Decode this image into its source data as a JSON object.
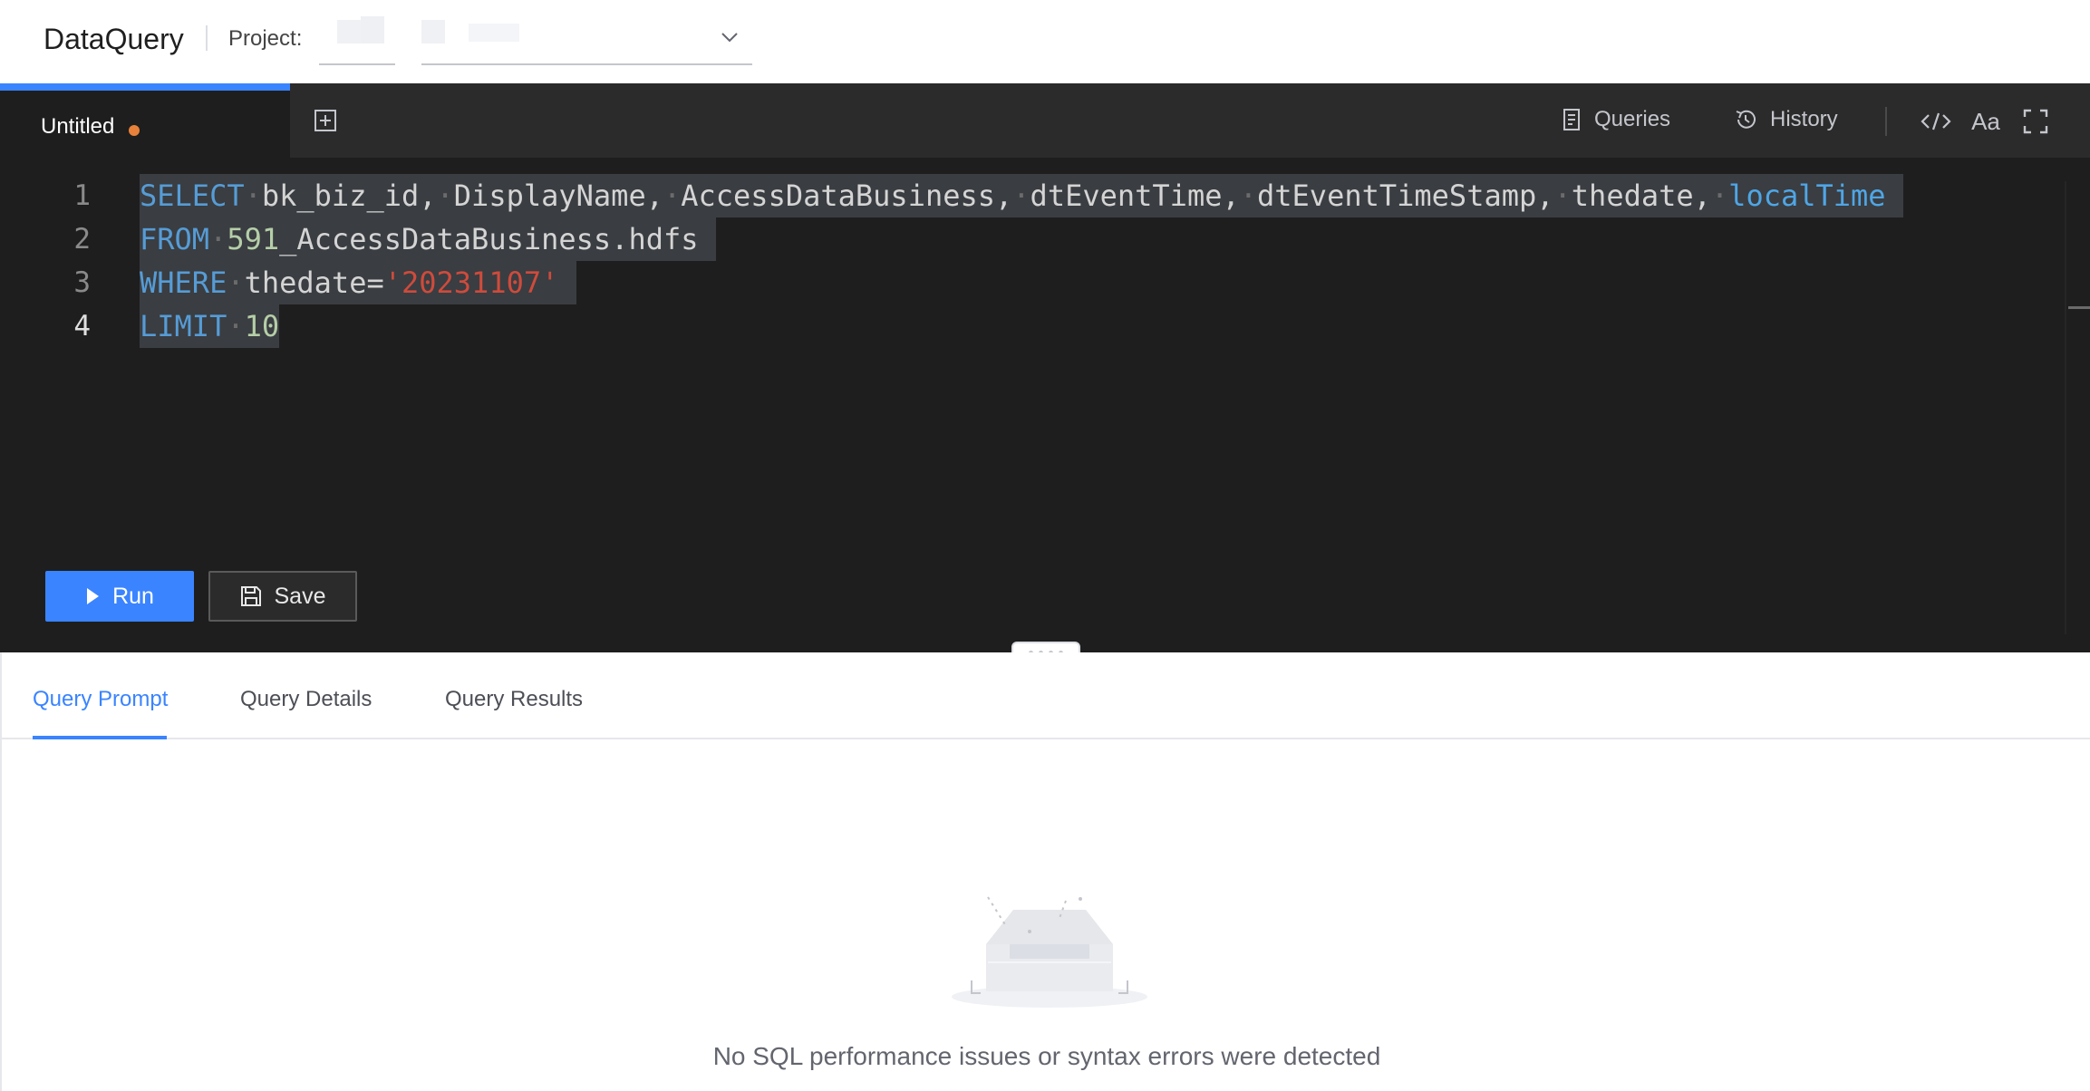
{
  "header": {
    "app_title": "DataQuery",
    "project_label": "Project:"
  },
  "editor": {
    "tab_label": "Untitled",
    "toolbar": {
      "queries_label": "Queries",
      "history_label": "History",
      "font_label": "Aa"
    },
    "line_numbers": [
      "1",
      "2",
      "3",
      "4"
    ],
    "code": {
      "line1": {
        "kw": "SELECT",
        "cols": [
          "bk_biz_id,",
          "DisplayName,",
          "AccessDataBusiness,",
          "dtEventTime,",
          "dtEventTimeStamp,",
          "thedate,"
        ],
        "last": "localTime"
      },
      "line2": {
        "kw": "FROM",
        "table_num": "591",
        "table_rest": "_AccessDataBusiness.hdfs"
      },
      "line3": {
        "kw": "WHERE",
        "col": "thedate=",
        "value": "'20231107'"
      },
      "line4": {
        "kw": "LIMIT",
        "value": "10"
      }
    },
    "run_label": "Run",
    "save_label": "Save"
  },
  "panel": {
    "tabs": [
      {
        "label": "Query Prompt",
        "active": true
      },
      {
        "label": "Query Details",
        "active": false
      },
      {
        "label": "Query Results",
        "active": false
      }
    ],
    "empty_message": "No SQL performance issues or syntax errors were detected"
  },
  "colors": {
    "accent": "#3a84ff",
    "editor_bg": "#1e1e1e",
    "unsaved_dot": "#e8813a",
    "keyword": "#569cd6",
    "string": "#ce4b3c"
  }
}
